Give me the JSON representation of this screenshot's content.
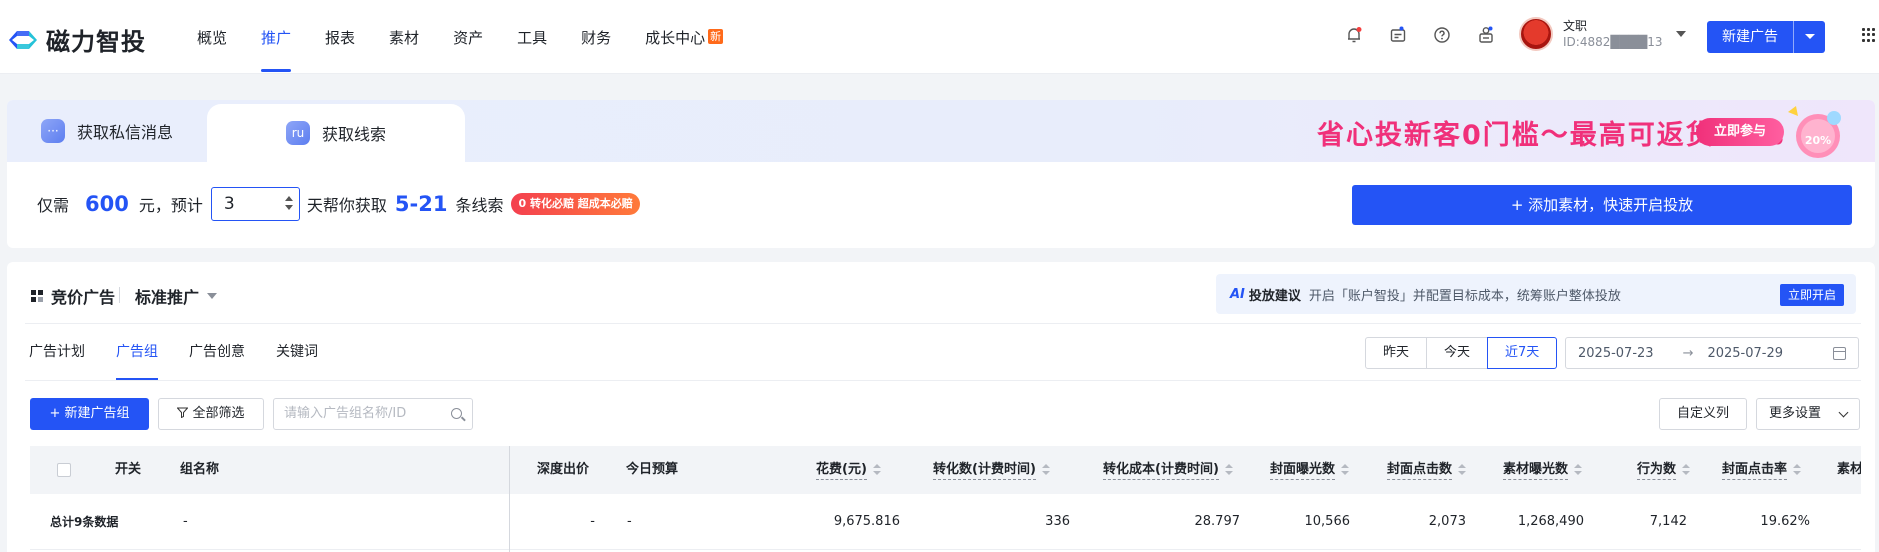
{
  "app": {
    "logo_text": "磁力智投",
    "nav": [
      {
        "label": "概览",
        "active": false
      },
      {
        "label": "推广",
        "active": true
      },
      {
        "label": "报表",
        "active": false
      },
      {
        "label": "素材",
        "active": false
      },
      {
        "label": "资产",
        "active": false
      },
      {
        "label": "工具",
        "active": false
      },
      {
        "label": "财务",
        "active": false
      },
      {
        "label": "成长中心",
        "active": false,
        "badge": "新"
      }
    ],
    "top_icons": [
      "notification-icon",
      "message-icon",
      "help-icon",
      "contact-icon"
    ],
    "user": {
      "name": "文职",
      "id": "ID:4882████13"
    },
    "new_ad_button": "新建广告",
    "accent_color": "#2454f5"
  },
  "promo": {
    "tabs": [
      {
        "label": "获取私信消息",
        "active": false
      },
      {
        "label": "获取线索",
        "active": true
      }
    ],
    "banner_text": "省心投新客0门槛～最高可返货20%",
    "banner_join": "立即参与",
    "banner_badge": "20%",
    "sentence": {
      "prefix": "仅需",
      "amount": "600",
      "unit": "元，预计",
      "days": "3",
      "mid": "天帮你获取",
      "range": "5-21",
      "suffix": "条线索",
      "guarantee": "0 转化必赔 超成本必赔"
    },
    "add_material_button": "+ 添加素材，快速开启投放"
  },
  "main": {
    "bid_title": "竞价广告",
    "std_select": "标准推广",
    "advice": {
      "title": "投放建议",
      "text": "开启「账户智投」并配置目标成本，统筹账户整体投放",
      "button": "立即开启"
    },
    "subtabs": [
      {
        "label": "广告计划",
        "active": false
      },
      {
        "label": "广告组",
        "active": true
      },
      {
        "label": "广告创意",
        "active": false
      },
      {
        "label": "关键词",
        "active": false
      }
    ],
    "range_buttons": [
      {
        "label": "昨天",
        "active": false
      },
      {
        "label": "今天",
        "active": false
      },
      {
        "label": "近7天",
        "active": true
      }
    ],
    "date_start": "2025-07-23",
    "date_arrow": "→",
    "date_end": "2025-07-29",
    "new_group_button": "+ 新建广告组",
    "filter_button": "全部筛选",
    "search_placeholder": "请输入广告组名称/ID",
    "custom_cols_button": "自定义列",
    "more_settings_button": "更多设置"
  },
  "table": {
    "headers": {
      "switch": "开关",
      "name": "组名称",
      "depth_bid": "深度出价",
      "today_budget": "今日预算",
      "cost": "花费(元)",
      "conversions": "转化数(计费时间)",
      "conv_cost": "转化成本(计费时间)",
      "cover_impr": "封面曝光数",
      "cover_clicks": "封面点击数",
      "material_impr": "素材曝光数",
      "actions": "行为数",
      "cover_ctr": "封面点击率",
      "more": "素材"
    },
    "summary_row": {
      "label": "总计9条数据",
      "name": "-",
      "depth_bid": "-",
      "today_budget": "-",
      "cost": "9,675.816",
      "conversions": "336",
      "conv_cost": "28.797",
      "cover_impr": "10,566",
      "cover_clicks": "2,073",
      "material_impr": "1,268,490",
      "actions": "7,142",
      "cover_ctr": "19.62%"
    }
  }
}
